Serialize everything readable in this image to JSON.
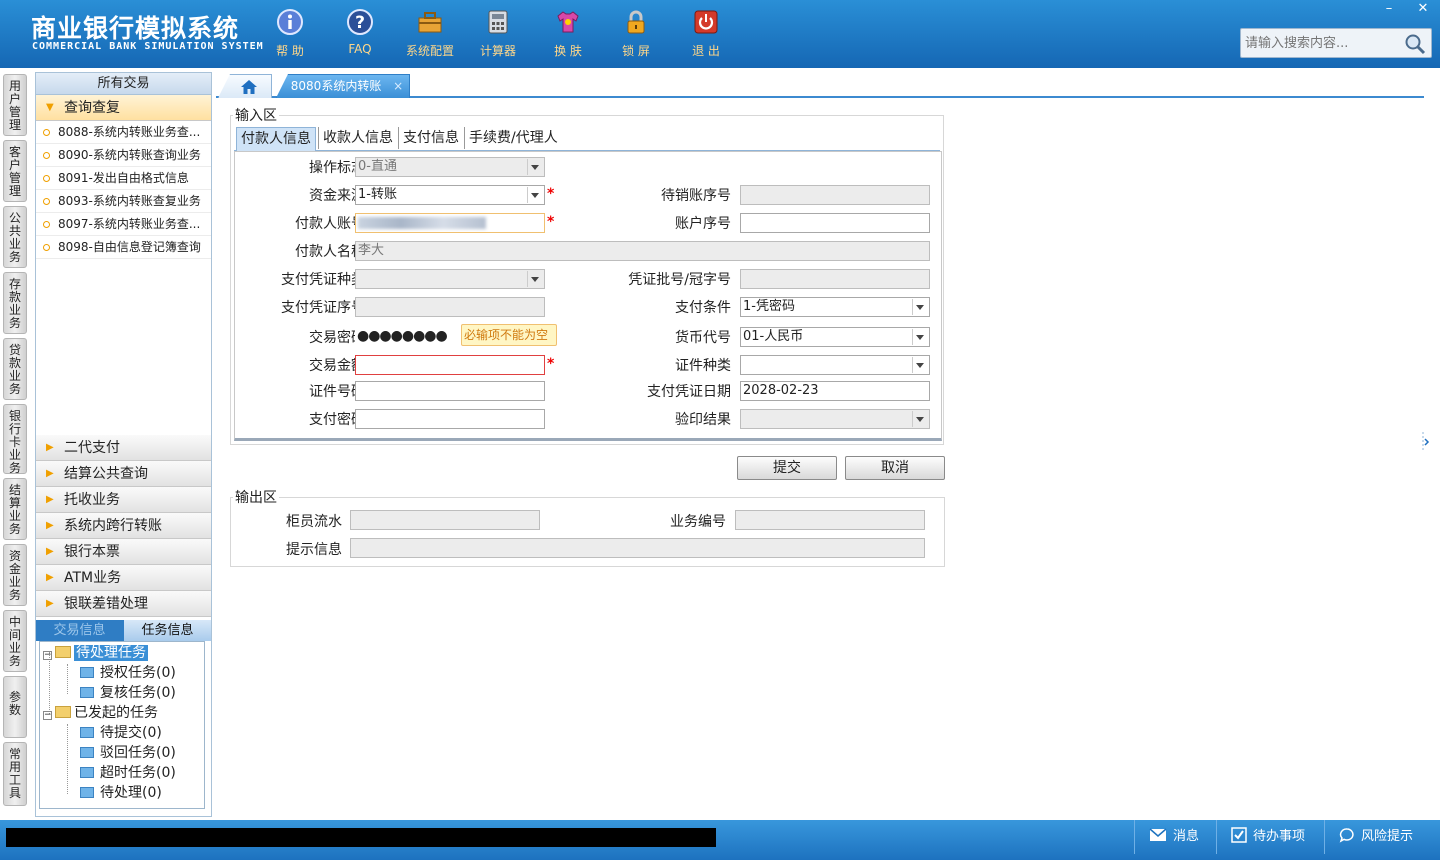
{
  "app": {
    "title_cn": "商业银行模拟系统",
    "title_en": "COMMERCIAL BANK SIMULATION SYSTEM"
  },
  "toolbar": [
    {
      "label": "帮 助",
      "icon": "info-icon"
    },
    {
      "label": "FAQ",
      "icon": "question-icon"
    },
    {
      "label": "系统配置",
      "icon": "toolbox-icon"
    },
    {
      "label": "计算器",
      "icon": "calculator-icon"
    },
    {
      "label": "换 肤",
      "icon": "shirt-icon"
    },
    {
      "label": "锁 屏",
      "icon": "lock-icon"
    },
    {
      "label": "退 出",
      "icon": "power-icon"
    }
  ],
  "window": {
    "minimize": "–",
    "close": "✕"
  },
  "search": {
    "placeholder": "请输入搜索内容..."
  },
  "vertical_tabs": [
    "用户管理",
    "客户管理",
    "公共业务",
    "存款业务",
    "贷款业务",
    "银行卡业务",
    "结算业务",
    "资金业务",
    "中间业务",
    "参数",
    "常用工具"
  ],
  "nav": {
    "header": "所有交易",
    "open_group": "查询查复",
    "items": [
      "8088-系统内转账业务查...",
      "8090-系统内转账查询业务",
      "8091-发出自由格式信息",
      "8093-系统内转账查复业务",
      "8097-系统内转账业务查...",
      "8098-自由信息登记簿查询"
    ],
    "groups": [
      "二代支付",
      "结算公共查询",
      "托收业务",
      "系统内跨行转账",
      "银行本票",
      "ATM业务",
      "银联差错处理"
    ]
  },
  "task_panel": {
    "tabs": [
      "交易信息",
      "任务信息"
    ],
    "tree": {
      "pending": "待处理任务",
      "pending_children": [
        "授权任务(0)",
        "复核任务(0)"
      ],
      "initiated": "已发起的任务",
      "initiated_children": [
        "待提交(0)",
        "驳回任务(0)",
        "超时任务(0)",
        "待处理(0)"
      ]
    }
  },
  "main_tabs": {
    "active": "8080系统内转账",
    "close": "×"
  },
  "input_area": {
    "legend": "输入区",
    "subtabs": [
      "付款人信息",
      "收款人信息",
      "支付信息",
      "手续费/代理人"
    ],
    "fields": {
      "op_flag": {
        "label": "操作标志",
        "value": "0-直通"
      },
      "fund_source": {
        "label": "资金来源",
        "value": "1-转账"
      },
      "pending_seq": {
        "label": "待销账序号",
        "value": ""
      },
      "payer_account": {
        "label": "付款人账号",
        "value": ""
      },
      "account_seq": {
        "label": "账户序号",
        "value": ""
      },
      "payer_name": {
        "label": "付款人名称",
        "value": "李大"
      },
      "voucher_type": {
        "label": "支付凭证种类",
        "value": ""
      },
      "voucher_batch": {
        "label": "凭证批号/冠字号",
        "value": ""
      },
      "voucher_seq": {
        "label": "支付凭证序号",
        "value": ""
      },
      "pay_condition": {
        "label": "支付条件",
        "value": "1-凭密码"
      },
      "tx_password": {
        "label": "交易密码",
        "value": "●●●●●●●●"
      },
      "currency": {
        "label": "货币代号",
        "value": "01-人民币"
      },
      "amount": {
        "label": "交易金额",
        "value": ""
      },
      "id_type": {
        "label": "证件种类",
        "value": ""
      },
      "id_number": {
        "label": "证件号码",
        "value": ""
      },
      "voucher_date": {
        "label": "支付凭证日期",
        "value": "2028-02-23"
      },
      "pay_password": {
        "label": "支付密码",
        "value": ""
      },
      "seal_result": {
        "label": "验印结果",
        "value": ""
      }
    },
    "tooltip": "必输项不能为空",
    "required_mark": "*"
  },
  "buttons": {
    "submit": "提交",
    "cancel": "取消"
  },
  "output_area": {
    "legend": "输出区",
    "teller_serial": {
      "label": "柜员流水",
      "value": ""
    },
    "business_no": {
      "label": "业务编号",
      "value": ""
    },
    "message": {
      "label": "提示信息",
      "value": ""
    }
  },
  "statusbar": {
    "messages": "消息",
    "todo": "待办事项",
    "risk": "风险提示"
  },
  "colors": {
    "header": "#1a73c2",
    "accent": "#3c8ad0",
    "required": "#e00000",
    "tooltip_bg": "#fff6c4"
  }
}
